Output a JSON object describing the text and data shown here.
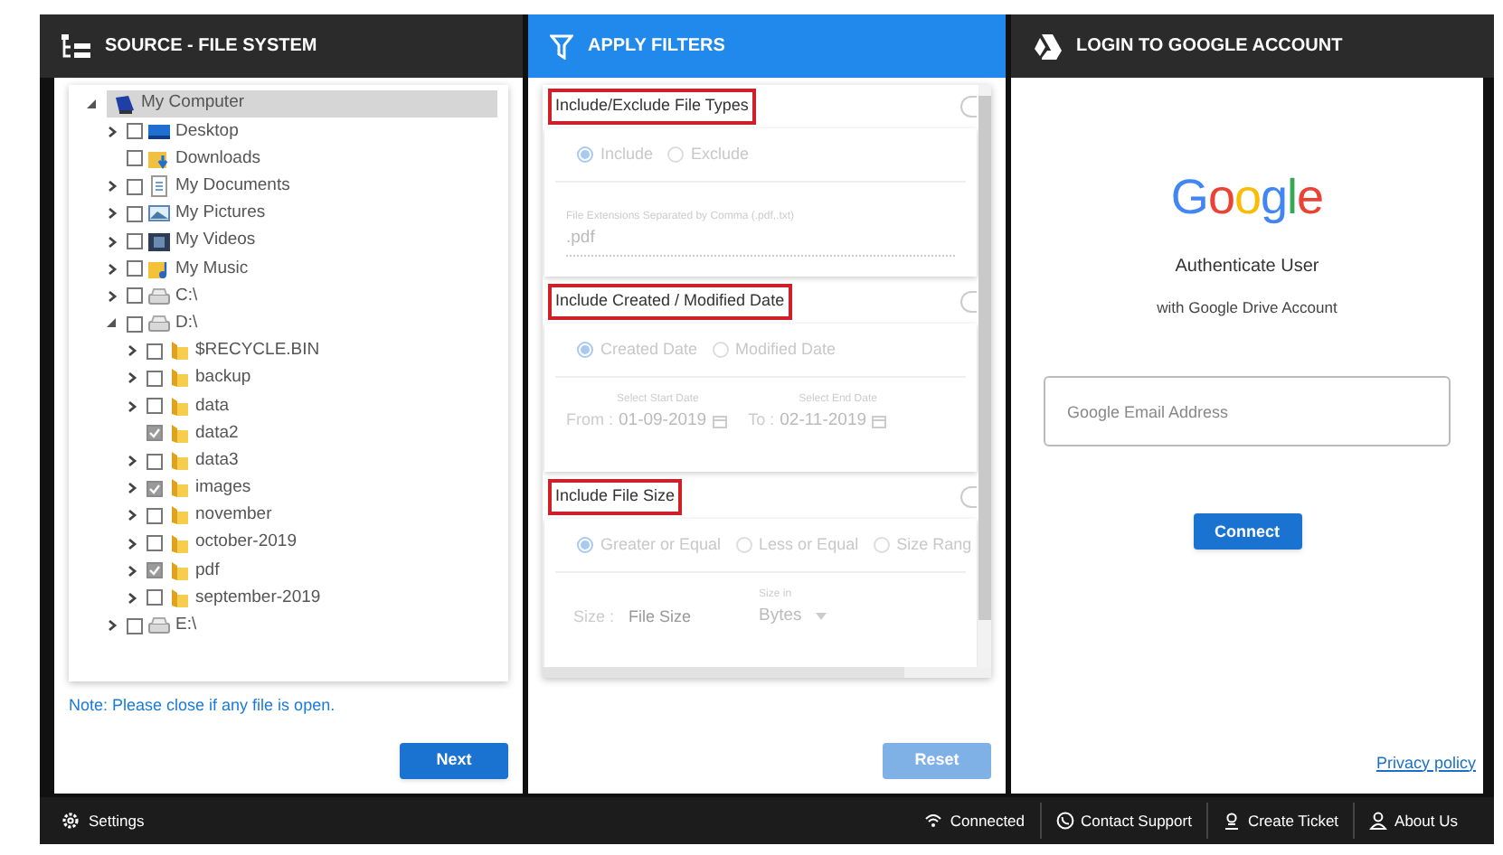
{
  "source": {
    "title": "SOURCE - FILE SYSTEM",
    "tree": [
      {
        "label": "My Computer",
        "kind": "computer",
        "selected": true,
        "expandable": true,
        "expanded": true,
        "children": [
          {
            "label": "Desktop",
            "kind": "desktop",
            "selected": false,
            "checked": false,
            "expandable": true,
            "expanded": false
          },
          {
            "label": "Downloads",
            "kind": "downloads",
            "selected": false,
            "checked": false
          },
          {
            "label": "My Documents",
            "kind": "documents",
            "selected": false,
            "checked": false,
            "expandable": true,
            "expanded": false
          },
          {
            "label": "My Pictures",
            "kind": "pictures",
            "selected": false,
            "checked": false,
            "expandable": true,
            "expanded": false
          },
          {
            "label": "My Videos",
            "kind": "videos",
            "selected": false,
            "checked": false,
            "expandable": true,
            "expanded": false
          },
          {
            "label": "My Music",
            "kind": "music",
            "selected": false,
            "checked": false,
            "expandable": true,
            "expanded": false
          },
          {
            "label": "C:\\",
            "kind": "drive",
            "selected": false,
            "checked": false,
            "expandable": true,
            "expanded": false
          },
          {
            "label": "D:\\",
            "kind": "drive",
            "selected": false,
            "checked": false,
            "expandable": true,
            "expanded": true,
            "children": [
              {
                "label": "$RECYCLE.BIN",
                "kind": "folder",
                "selected": false,
                "checked": false,
                "expandable": true,
                "expanded": false
              },
              {
                "label": "backup",
                "kind": "folder",
                "selected": false,
                "checked": false,
                "expandable": true,
                "expanded": false
              },
              {
                "label": "data",
                "kind": "folder",
                "selected": false,
                "checked": false,
                "expandable": true,
                "expanded": false
              },
              {
                "label": "data2",
                "kind": "folder",
                "selected": false,
                "checked": true
              },
              {
                "label": "data3",
                "kind": "folder",
                "selected": false,
                "checked": false,
                "expandable": true,
                "expanded": false
              },
              {
                "label": "images",
                "kind": "folder",
                "selected": false,
                "checked": true,
                "expandable": true,
                "expanded": false
              },
              {
                "label": "november",
                "kind": "folder",
                "selected": false,
                "checked": false,
                "expandable": true,
                "expanded": false
              },
              {
                "label": "october-2019",
                "kind": "folder",
                "selected": false,
                "checked": false,
                "expandable": true,
                "expanded": false
              },
              {
                "label": "pdf",
                "kind": "folder",
                "selected": false,
                "checked": true,
                "expandable": true,
                "expanded": false
              },
              {
                "label": "september-2019",
                "kind": "folder",
                "selected": false,
                "checked": false,
                "expandable": true,
                "expanded": false
              }
            ]
          },
          {
            "label": "E:\\",
            "kind": "drive",
            "selected": false,
            "checked": false,
            "expandable": true,
            "expanded": false
          }
        ]
      }
    ],
    "note": "Note: Please close if any file is open.",
    "next_button": "Next"
  },
  "filters": {
    "title": "APPLY FILTERS",
    "sections": [
      {
        "kind": "types",
        "title": "Include/Exclude File Types",
        "enabled": false,
        "radios": [
          {
            "label": "Include",
            "selected": true
          },
          {
            "label": "Exclude",
            "selected": false
          }
        ],
        "field": {
          "label": "File Extensions Separated by Comma (.pdf,.txt)",
          "value": ".pdf"
        }
      },
      {
        "kind": "dates",
        "title": "Include Created / Modified Date",
        "enabled": false,
        "radios": [
          {
            "label": "Created Date",
            "selected": true
          },
          {
            "label": "Modified Date",
            "selected": false
          }
        ],
        "dates": [
          {
            "label": "Select Start Date",
            "prefix": "From :",
            "value": "01-09-2019"
          },
          {
            "label": "Select End Date",
            "prefix": "To :",
            "value": "02-11-2019"
          }
        ]
      },
      {
        "kind": "size",
        "title": "Include File Size",
        "enabled": false,
        "radios": [
          {
            "label": "Greater or Equal",
            "selected": true
          },
          {
            "label": "Less or Equal",
            "selected": false
          },
          {
            "label": "Size Rang",
            "selected": false
          }
        ],
        "size": {
          "prefix": "Size :",
          "placeholder": "File Size",
          "unit_label": "Size in",
          "unit": "Bytes"
        }
      }
    ],
    "reset_button": {
      "label": "Reset",
      "disabled": true
    }
  },
  "login": {
    "title": "LOGIN TO GOOGLE ACCOUNT",
    "logo": "Google",
    "heading": "Authenticate User",
    "subheading": "with Google Drive Account",
    "email": {
      "placeholder": "Google Email Address"
    },
    "connect_button": "Connect",
    "privacy_link": "Privacy policy"
  },
  "status_bar": {
    "settings": "Settings",
    "items": [
      {
        "kind": "wifi",
        "label": "Connected"
      },
      {
        "kind": "phone",
        "label": "Contact Support"
      },
      {
        "kind": "ticket",
        "label": "Create Ticket"
      },
      {
        "kind": "person",
        "label": "About Us"
      }
    ]
  }
}
